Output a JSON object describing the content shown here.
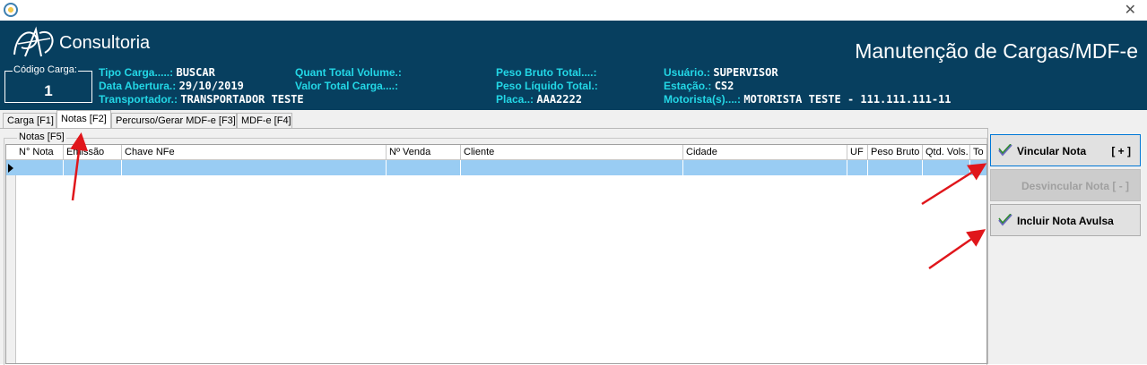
{
  "header": {
    "brand": "Consultoria",
    "screen_title": "Manutenção de Cargas/MDF-e",
    "code_label": "Código Carga:",
    "code_value": "1",
    "colors": {
      "bg": "#073f5f",
      "key": "#23d7e6",
      "value": "#ffffff"
    }
  },
  "info": {
    "tipo_carga_k": "Tipo Carga.....:",
    "tipo_carga_v": "BUSCAR",
    "data_abertura_k": "Data Abertura.:",
    "data_abertura_v": "29/10/2019",
    "transportador_k": "Transportador.:",
    "transportador_v": "TRANSPORTADOR TESTE",
    "quant_volume_k": "Quant Total Volume.:",
    "valor_carga_k": "Valor Total Carga....:",
    "peso_bruto_k": "Peso Bruto Total....:",
    "peso_liquido_k": "Peso Líquido Total.:",
    "placa_k": "Placa..:",
    "placa_v": "AAA2222",
    "usuario_k": "Usuário.:",
    "usuario_v": "SUPERVISOR",
    "estacao_k": "Estação.:",
    "estacao_v": "CS2",
    "motorista_k": "Motorista(s)....:",
    "motorista_v": "MOTORISTA TESTE - 111.111.111-11"
  },
  "tabs": [
    {
      "label": "Carga [F1]"
    },
    {
      "label": "Notas [F2]",
      "active": true
    },
    {
      "label": "Percurso/Gerar MDF-e [F3]"
    },
    {
      "label": "MDF-e [F4]"
    }
  ],
  "group_label": "Notas [F5]",
  "grid": {
    "columns": [
      "N° Nota",
      "Emissão",
      "Chave NFe",
      "Nº Venda",
      "Cliente",
      "Cidade",
      "UF",
      "Peso Bruto",
      "Qtd. Vols.",
      "To"
    ],
    "selection_color": "#99ccf3"
  },
  "buttons": {
    "vincular_label": "Vincular Nota",
    "vincular_shortcut": "[ + ]",
    "desvincular_label": "Desvincular Nota [ - ]",
    "incluir_label": "Incluir Nota Avulsa"
  },
  "annotations": {
    "arrow_color": "#e0161b"
  }
}
